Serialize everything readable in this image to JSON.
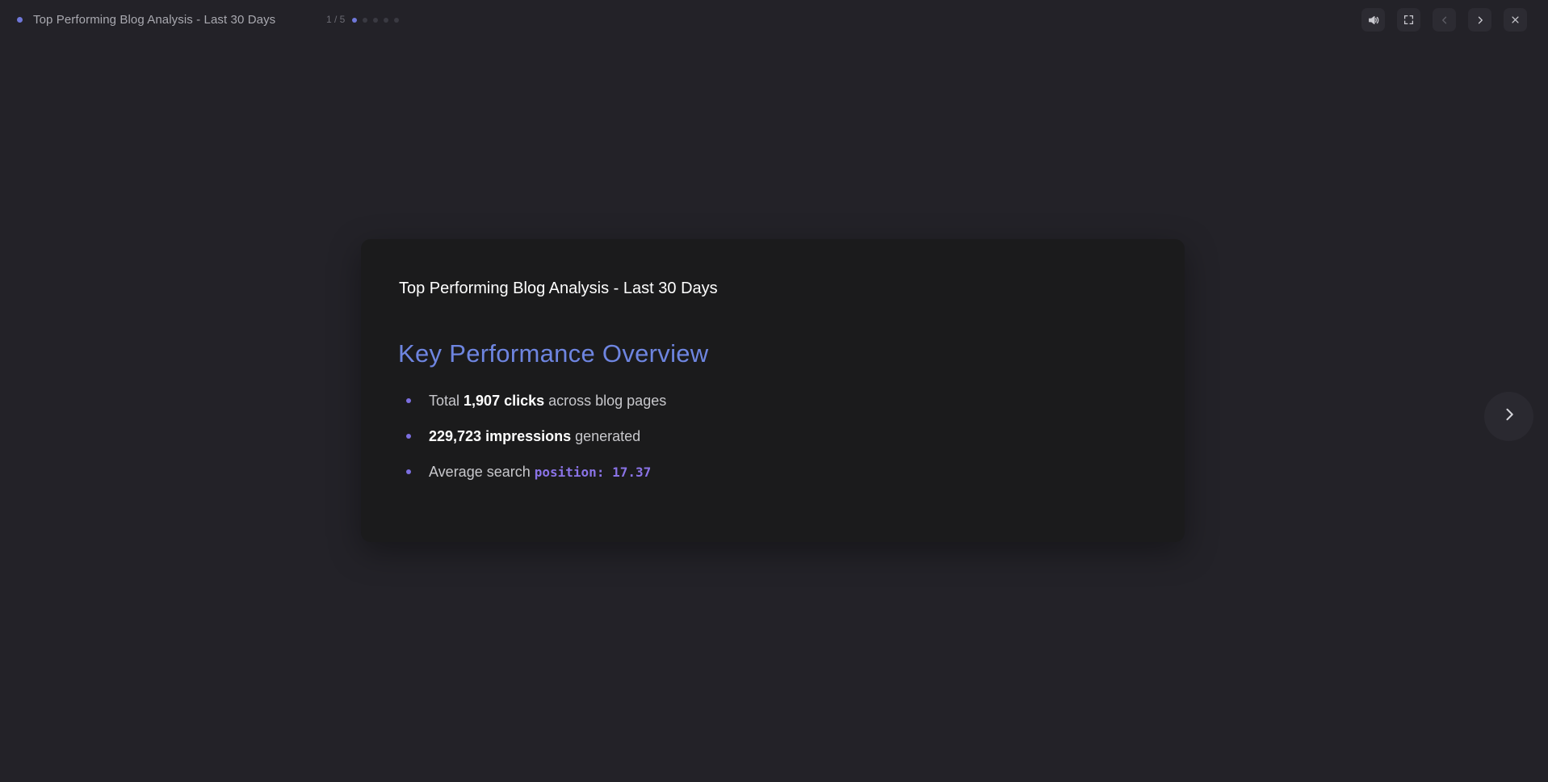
{
  "header": {
    "title": "Top Performing Blog Analysis - Last 30 Days",
    "counter": "1 / 5",
    "slide_count": 5,
    "current_slide": 1,
    "accent_color": "#6f77d9"
  },
  "controls": {
    "sound_icon": "speaker-icon",
    "fullscreen_icon": "fullscreen-icon",
    "prev_icon": "chevron-left-icon",
    "next_icon": "chevron-right-icon",
    "close_icon": "close-icon"
  },
  "slide": {
    "title": "Top Performing Blog Analysis - Last 30 Days",
    "heading": "Key Performance Overview",
    "heading_color": "#6e85e0",
    "bullets": [
      {
        "pre": "Total ",
        "bold": "1,907 clicks",
        "post": " across blog pages"
      },
      {
        "pre": "",
        "bold": "229,723 impressions",
        "post": " generated"
      },
      {
        "pre": "Average search ",
        "code": "position: 17.37"
      }
    ]
  },
  "side_nav": {
    "next_icon": "chevron-right-icon"
  }
}
